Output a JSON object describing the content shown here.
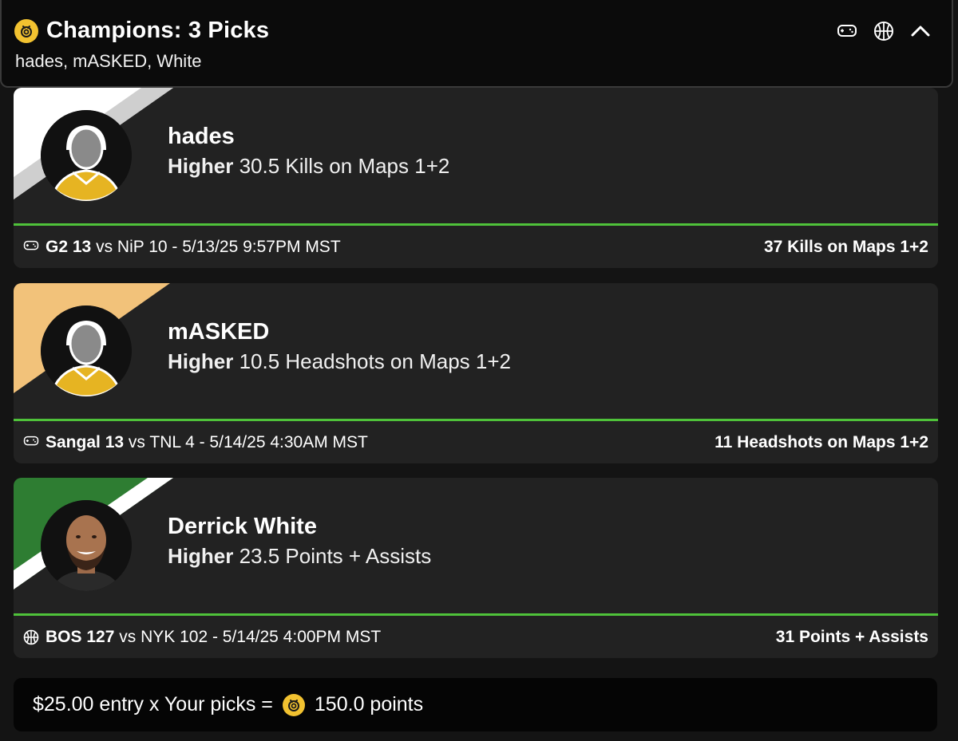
{
  "header": {
    "title": "Champions: 3 Picks",
    "subtitle": "hades, mASKED, White",
    "icons": [
      "coin-icon",
      "gamepad-icon",
      "basketball-icon",
      "chevron-up-icon"
    ]
  },
  "picks": [
    {
      "name": "hades",
      "direction": "Higher",
      "line": "30.5 Kills on Maps 1+2",
      "team1": "G2 13",
      "vs_text": "vs NiP 10 - 5/13/25 9:57PM MST",
      "result": "37 Kills on Maps 1+2",
      "sport_icon": "gamepad-icon",
      "colors": [
        "#ffffff",
        "#cfcfcf"
      ]
    },
    {
      "name": "mASKED",
      "direction": "Higher",
      "line": "10.5 Headshots on Maps 1+2",
      "team1": "Sangal 13",
      "vs_text": "vs TNL 4 - 5/14/25 4:30AM MST",
      "result": "11 Headshots on Maps 1+2",
      "sport_icon": "gamepad-icon",
      "colors": [
        "#f2c27a"
      ]
    },
    {
      "name": "Derrick White",
      "direction": "Higher",
      "line": "23.5 Points + Assists",
      "team1": "BOS 127",
      "vs_text": "vs NYK 102 - 5/14/25 4:00PM MST",
      "result": "31 Points + Assists",
      "sport_icon": "basketball-icon",
      "colors": [
        "#2e7d32",
        "#ffffff"
      ]
    }
  ],
  "summary": {
    "text_before": "$25.00 entry x Your picks =",
    "text_after": "150.0 points"
  },
  "colors": {
    "accent_green": "#4fc23a",
    "coin_yellow": "#f2c230",
    "card_bg": "#222222",
    "page_bg": "#141414"
  }
}
